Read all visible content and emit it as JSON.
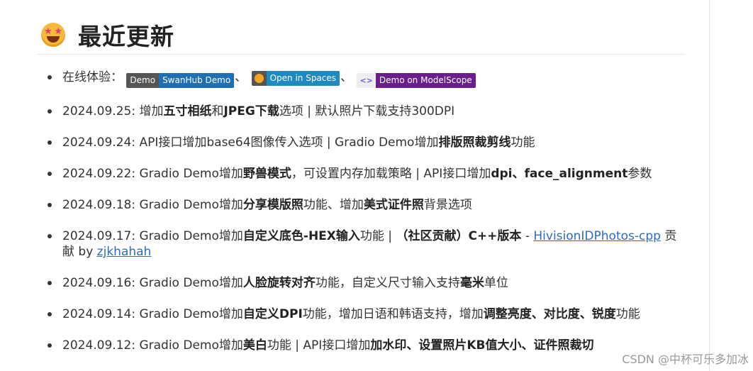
{
  "heading": {
    "title": "最近更新",
    "icon": "star-struck-emoji-icon"
  },
  "badges": {
    "intro": "在线体验：",
    "swanhub": {
      "left": "Demo",
      "right": "SwanHub Demo"
    },
    "huggingface": {
      "right": "Open in Spaces",
      "icon": "hugging-face-icon"
    },
    "modelscope": {
      "right": "Demo on ModelScope",
      "icon": "modelscope-icon"
    },
    "separator": "、"
  },
  "entries": [
    {
      "date": "2024.09.25:",
      "t1": " 增加",
      "b1": "五寸相纸",
      "t2": "和",
      "b2": "JPEG下载",
      "t3": "选项 | 默认照片下载支持300DPI"
    },
    {
      "date": "2024.09.24:",
      "t1": " API接口增加base64图像传入选项 | Gradio Demo增加",
      "b1": "排版照裁剪线",
      "t2": "功能"
    },
    {
      "date": "2024.09.22:",
      "t1": " Gradio Demo增加",
      "b1": "野兽模式",
      "t2": "，可设置内存加载策略 | API接口增加",
      "b2": "dpi、face_alignment",
      "t3": "参数"
    },
    {
      "date": "2024.09.18:",
      "t1": " Gradio Demo增加",
      "b1": "分享模版照",
      "t2": "功能、增加",
      "b2": "美式证件照",
      "t3": "背景选项"
    },
    {
      "date": "2024.09.17:",
      "t1": " Gradio Demo增加",
      "b1": "自定义底色-HEX输入",
      "t2": "功能 | ",
      "b2": "（社区贡献）C++版本",
      "t3": " - ",
      "link1": "HivisionIDPhotos-cpp",
      "t4": " 贡献 by ",
      "link2": "zjkhahah"
    },
    {
      "date": "2024.09.16:",
      "t1": " Gradio Demo增加",
      "b1": "人脸旋转对齐",
      "t2": "功能，自定义尺寸输入支持",
      "b2": "毫米",
      "t3": "单位"
    },
    {
      "date": "2024.09.14:",
      "t1": " Gradio Demo增加",
      "b1": "自定义DPI",
      "t2": "功能，增加日语和韩语支持，增加",
      "b2": "调整亮度、对比度、锐度",
      "t3": "功能"
    },
    {
      "date": "2024.09.12:",
      "t1": " Gradio Demo增加",
      "b1": "美白",
      "t2": "功能 | API接口增加",
      "b2": "加水印、设置照片KB值大小、证件照裁切"
    }
  ],
  "watermark": "CSDN @中杯可乐多加冰"
}
